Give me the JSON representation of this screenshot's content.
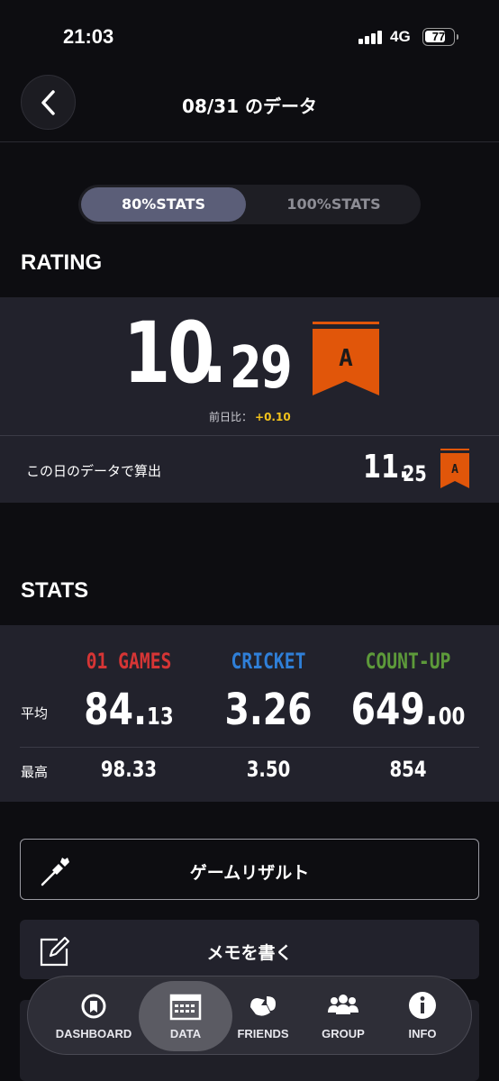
{
  "status_bar": {
    "time": "21:03",
    "network": "4G",
    "battery": "77",
    "battery_level_pct": 77
  },
  "header": {
    "title": "08/31 のデータ"
  },
  "stats_toggle": {
    "options": [
      "80%STATS",
      "100%STATS"
    ],
    "selected": "80%STATS"
  },
  "rating": {
    "section_title": "RATING",
    "value_int": "10",
    "value_dot": ".",
    "value_dec": "29",
    "grade": "A",
    "diff_label": "前日比：",
    "diff_value": "+0.10",
    "day_calc_label": "この日のデータで算出",
    "day_value_int": "11.",
    "day_value_dec": "25",
    "day_grade": "A"
  },
  "stats": {
    "section_title": "STATS",
    "columns": [
      {
        "name": "01 GAMES",
        "color": "#d63535",
        "avg_int": "84.",
        "avg_dec": "13",
        "max": "98.33"
      },
      {
        "name": "CRICKET",
        "color": "#2f7fd8",
        "avg_int": "3.26",
        "avg_dec": "",
        "max": "3.50"
      },
      {
        "name": "COUNT-UP",
        "color": "#5d9a3a",
        "avg_int": "649.",
        "avg_dec": "00",
        "max": "854"
      }
    ],
    "avg_label": "平均",
    "max_label": "最高"
  },
  "actions": {
    "game_result": "ゲームリザルト",
    "memo": "メモを書く"
  },
  "tab_bar": {
    "active": "DATA",
    "items": [
      {
        "label": "DASHBOARD",
        "icon": "gauge-icon"
      },
      {
        "label": "DATA",
        "icon": "calendar-icon"
      },
      {
        "label": "FRIENDS",
        "icon": "friends-icon"
      },
      {
        "label": "GROUP",
        "icon": "group-icon"
      },
      {
        "label": "INFO",
        "icon": "info-icon"
      }
    ]
  },
  "colors": {
    "accent_orange": "#e1560a",
    "panel": "#22222c",
    "background": "#0d0d11",
    "diff_yellow": "#f2c21b"
  }
}
